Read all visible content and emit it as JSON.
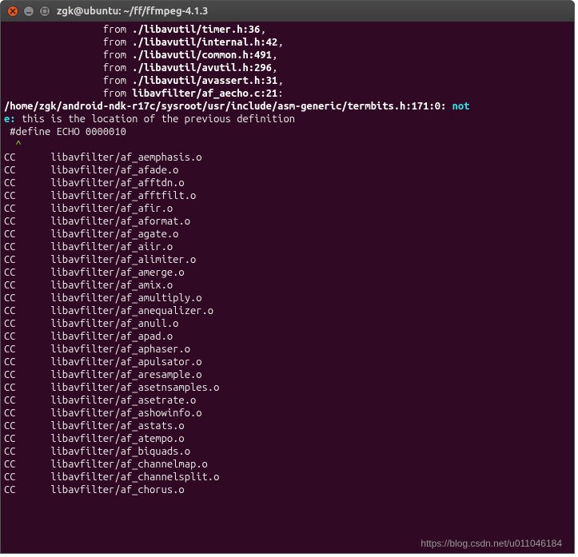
{
  "title": "zgk@ubuntu: ~/ff/ffmpeg-4.1.3",
  "includes": [
    {
      "prefix": "                 from ",
      "path": "./libavutil/timer.h:36"
    },
    {
      "prefix": "                 from ",
      "path": "./libavutil/internal.h:42"
    },
    {
      "prefix": "                 from ",
      "path": "./libavutil/common.h:491"
    },
    {
      "prefix": "                 from ",
      "path": "./libavutil/avutil.h:296"
    },
    {
      "prefix": "                 from ",
      "path": "./libavutil/avassert.h:31"
    },
    {
      "prefix": "                 from ",
      "path": "libavfilter/af_aecho.c:21"
    }
  ],
  "note_path": "/home/zgk/android-ndk-r17c/sysroot/usr/include/asm-generic/termbits.h:171:0: ",
  "note_label": "not",
  "note_label2": "e: ",
  "note_msg": "this is the location of the previous definition",
  "define_line": " #define ECHO 0000010",
  "caret_line": "  ^",
  "cc_lines": [
    "CC\tlibavfilter/af_aemphasis.o",
    "CC\tlibavfilter/af_afade.o",
    "CC\tlibavfilter/af_afftdn.o",
    "CC\tlibavfilter/af_afftfilt.o",
    "CC\tlibavfilter/af_afir.o",
    "CC\tlibavfilter/af_aformat.o",
    "CC\tlibavfilter/af_agate.o",
    "CC\tlibavfilter/af_aiir.o",
    "CC\tlibavfilter/af_alimiter.o",
    "CC\tlibavfilter/af_amerge.o",
    "CC\tlibavfilter/af_amix.o",
    "CC\tlibavfilter/af_amultiply.o",
    "CC\tlibavfilter/af_anequalizer.o",
    "CC\tlibavfilter/af_anull.o",
    "CC\tlibavfilter/af_apad.o",
    "CC\tlibavfilter/af_aphaser.o",
    "CC\tlibavfilter/af_apulsator.o",
    "CC\tlibavfilter/af_aresample.o",
    "CC\tlibavfilter/af_asetnsamples.o",
    "CC\tlibavfilter/af_asetrate.o",
    "CC\tlibavfilter/af_ashowinfo.o",
    "CC\tlibavfilter/af_astats.o",
    "CC\tlibavfilter/af_atempo.o",
    "CC\tlibavfilter/af_biquads.o",
    "CC\tlibavfilter/af_channelmap.o",
    "CC\tlibavfilter/af_channelsplit.o",
    "CC\tlibavfilter/af_chorus.o"
  ],
  "watermark": "https://blog.csdn.net/u011046184"
}
